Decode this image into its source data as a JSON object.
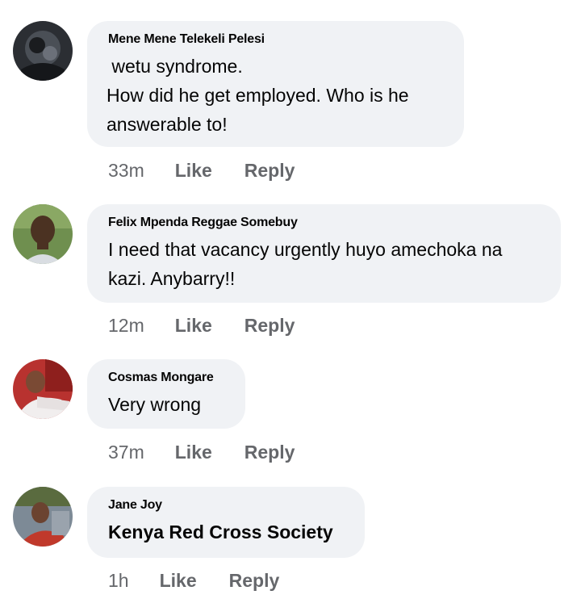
{
  "comments": [
    {
      "author": "Mene Mene Telekeli Pelesi",
      "text": " wetu syndrome.\nHow did he get employed. Who is he\nanswerable to!",
      "time": "33m",
      "like_label": "Like",
      "reply_label": "Reply"
    },
    {
      "author": "Felix Mpenda Reggae Somebuy",
      "text": "I need that vacancy urgently huyo amechoka na\nkazi. Anybarry!!",
      "time": "12m",
      "like_label": "Like",
      "reply_label": "Reply"
    },
    {
      "author": "Cosmas Mongare",
      "text": "Very wrong",
      "time": "37m",
      "like_label": "Like",
      "reply_label": "Reply"
    },
    {
      "author": "Jane Joy",
      "text": "Kenya Red Cross Society",
      "time": "1h",
      "like_label": "Like",
      "reply_label": "Reply"
    }
  ],
  "colors": {
    "bubble": "#f0f2f5",
    "meta_text": "#65676b",
    "body_text": "#050505"
  }
}
